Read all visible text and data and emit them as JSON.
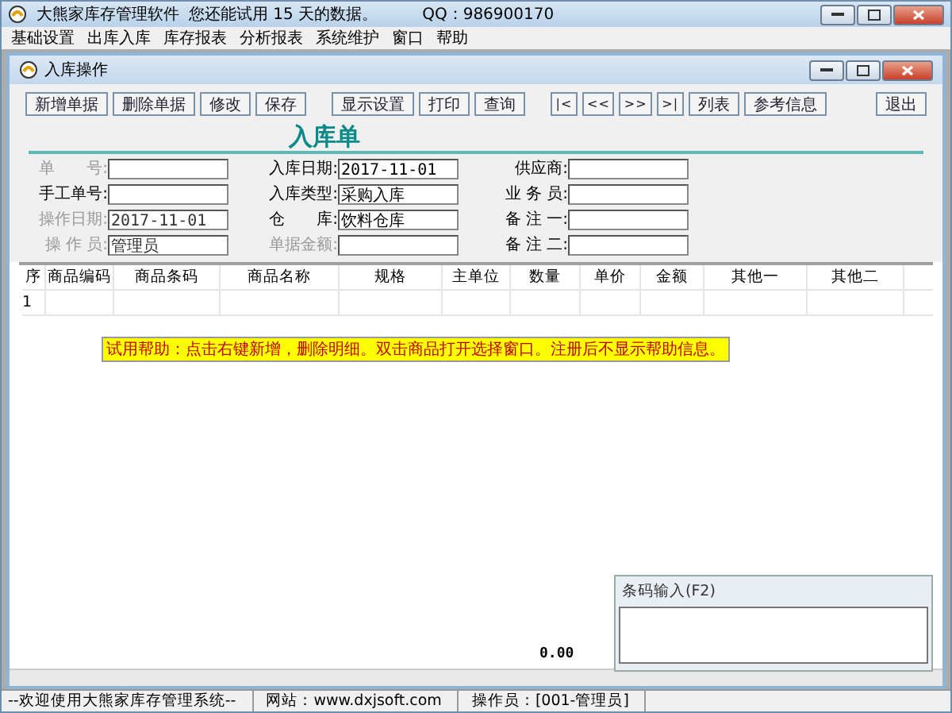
{
  "window": {
    "title": "大熊家库存管理软件",
    "trial_notice": "您还能试用 15 天的数据。",
    "qq": "QQ：986900170"
  },
  "menu": [
    "基础设置",
    "出库入库",
    "库存报表",
    "分析报表",
    "系统维护",
    "窗口",
    "帮助"
  ],
  "child_window": {
    "title": "入库操作"
  },
  "toolbar": [
    {
      "kind": "button",
      "label": "新增单据"
    },
    {
      "kind": "button",
      "label": "删除单据"
    },
    {
      "kind": "button",
      "label": "修改"
    },
    {
      "kind": "button",
      "label": "保存"
    },
    {
      "kind": "gap"
    },
    {
      "kind": "button",
      "label": "显示设置"
    },
    {
      "kind": "button",
      "label": "打印"
    },
    {
      "kind": "button",
      "label": "查询"
    },
    {
      "kind": "gap"
    },
    {
      "kind": "nav",
      "label": "|<"
    },
    {
      "kind": "nav",
      "label": "<<"
    },
    {
      "kind": "nav",
      "label": ">>"
    },
    {
      "kind": "nav",
      "label": ">|"
    },
    {
      "kind": "button",
      "label": "列表"
    },
    {
      "kind": "button",
      "label": "参考信息"
    },
    {
      "kind": "spacer"
    },
    {
      "kind": "button",
      "label": "退出"
    }
  ],
  "form": {
    "title": "入库单",
    "fields": [
      {
        "label": "单　　号:",
        "disabled": true
      },
      {
        "label": "入库日期:",
        "value": "2017-11-01",
        "disabled": false
      },
      {
        "label": "供应商:",
        "disabled": false
      },
      {
        "label": "手工单号:",
        "disabled": false
      },
      {
        "label": "入库类型:",
        "value": "采购入库",
        "disabled": false
      },
      {
        "label": "业 务 员:",
        "disabled": false
      },
      {
        "label": "操作日期:",
        "value": "2017-11-01",
        "disabled": true
      },
      {
        "label": "仓　　库:",
        "value": "饮料仓库",
        "disabled": false
      },
      {
        "label": "备 注 一:",
        "disabled": false
      },
      {
        "label": "操 作 员:",
        "value": "管理员",
        "disabled": true
      },
      {
        "label": "单据金额:",
        "disabled": true
      },
      {
        "label": "备 注 二:",
        "disabled": false
      }
    ]
  },
  "table": {
    "columns": [
      "序",
      "商品编码",
      "商品条码",
      "商品名称",
      "规格",
      "主单位",
      "数量",
      "单价",
      "金额",
      "其他一",
      "其他二"
    ],
    "rows": [
      [
        "1"
      ]
    ]
  },
  "help_text": "试用帮助：点击右键新增，删除明细。双击商品打开选择窗口。注册后不显示帮助信息。",
  "total": "0.00",
  "barcode_panel": {
    "title": "条码输入(F2)"
  },
  "status_bar": [
    "--欢迎使用大熊家库存管理系统--",
    "网站：www.dxjsoft.com",
    "操作员：[001-管理员]"
  ]
}
